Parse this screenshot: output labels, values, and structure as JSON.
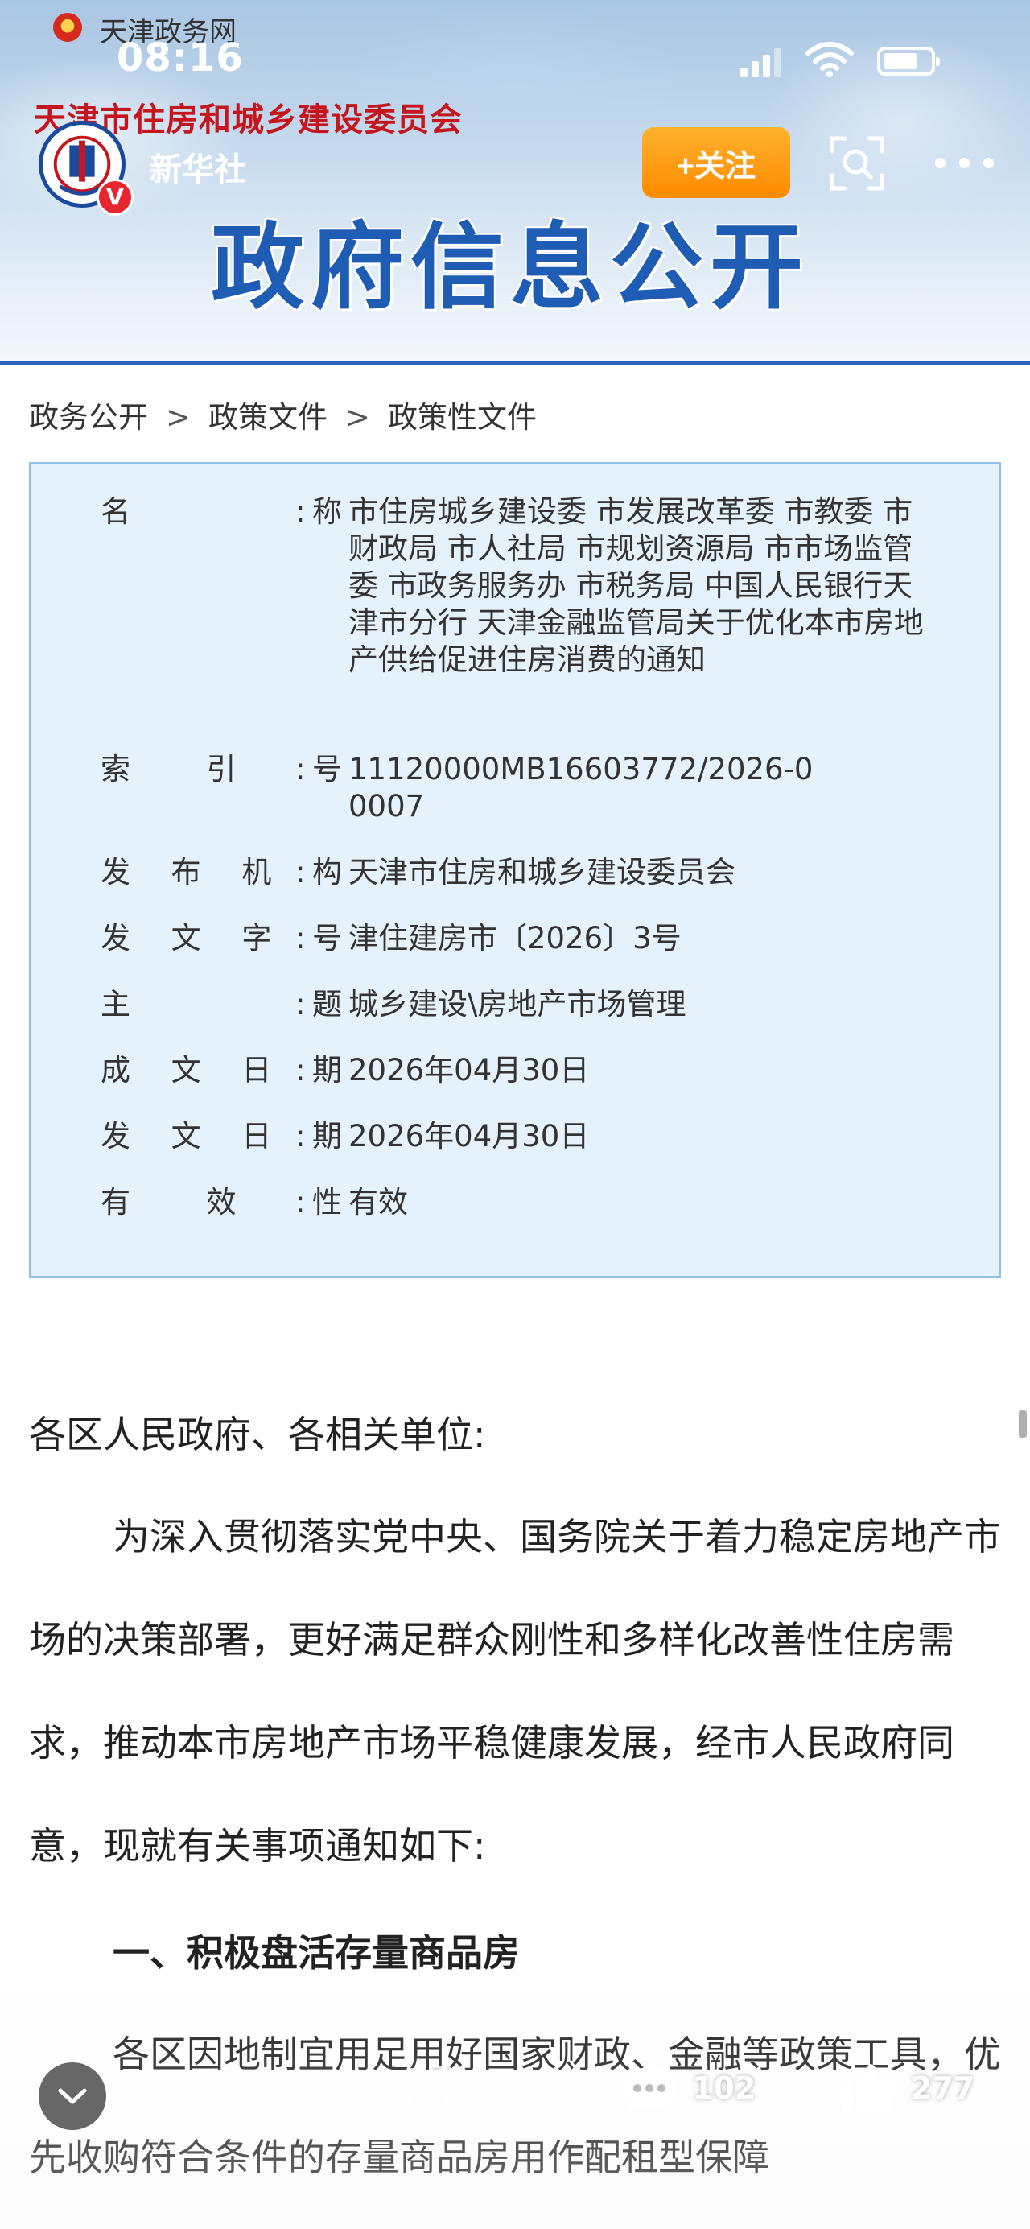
{
  "status_bar": {
    "site_name": "天津政务网",
    "time": "08:16"
  },
  "header": {
    "org_title": "天津市住房和城乡建设委员会",
    "account_name": "新华社",
    "verified_label": "V",
    "follow_label": "+关注",
    "headline": "政府信息公开"
  },
  "breadcrumb": {
    "items": [
      "政务公开",
      "政策文件",
      "政策性文件"
    ],
    "separator": ">"
  },
  "info": {
    "name_label": "名称",
    "name_value": "市住房城乡建设委 市发展改革委 市教委 市财政局 市人社局 市规划资源局 市市场监管委 市政务服务办 市税务局 中国人民银行天津市分行 天津金融监管局关于优化本市房地产供给促进住房消费的通知",
    "index_label": "索引号",
    "index_value": "11120000MB16603772/2026-00007",
    "issuer_label": "发布机构",
    "issuer_value": "天津市住房和城乡建设委员会",
    "doc_no_label": "发文字号",
    "doc_no_value": "津住建房市〔2026〕3号",
    "subject_label": "主题",
    "subject_value": "城乡建设\\房地产市场管理",
    "written_date_label": "成文日期",
    "written_date_value": "2026年04月30日",
    "issue_date_label": "发文日期",
    "issue_date_value": "2026年04月30日",
    "validity_label": "有效性",
    "validity_value": "有效",
    "colon": ":"
  },
  "body": {
    "salutation": "各区人民政府、各相关单位:",
    "para1": "为深入贯彻落实党中央、国务院关于着力稳定房地产市场的决策部署，更好满足群众刚性和多样化改善性住房需求，推动本市房地产市场平稳健康发展，经市人民政府同意，现就有关事项通知如下:",
    "heading1": "一、积极盘活存量商品房",
    "para2": "各区因地制宜用足用好国家财政、金融等政策工具，优先收购符合条件的存量商品房用作配租型保障"
  },
  "bottom_bar": {
    "comment_count": "102",
    "like_count": "277"
  },
  "colors": {
    "brand_red": "#c5161d",
    "headline_blue": "#1f5db5",
    "info_bg": "#e5f1fb",
    "info_border": "#8fc0e6",
    "follow_orange": "#ff9a10"
  },
  "icons": [
    "emblem-icon",
    "signal-icon",
    "wifi-icon",
    "battery-icon",
    "scan-icon",
    "more-icon",
    "chevron-down-icon",
    "share-icon",
    "comment-icon",
    "like-icon"
  ]
}
